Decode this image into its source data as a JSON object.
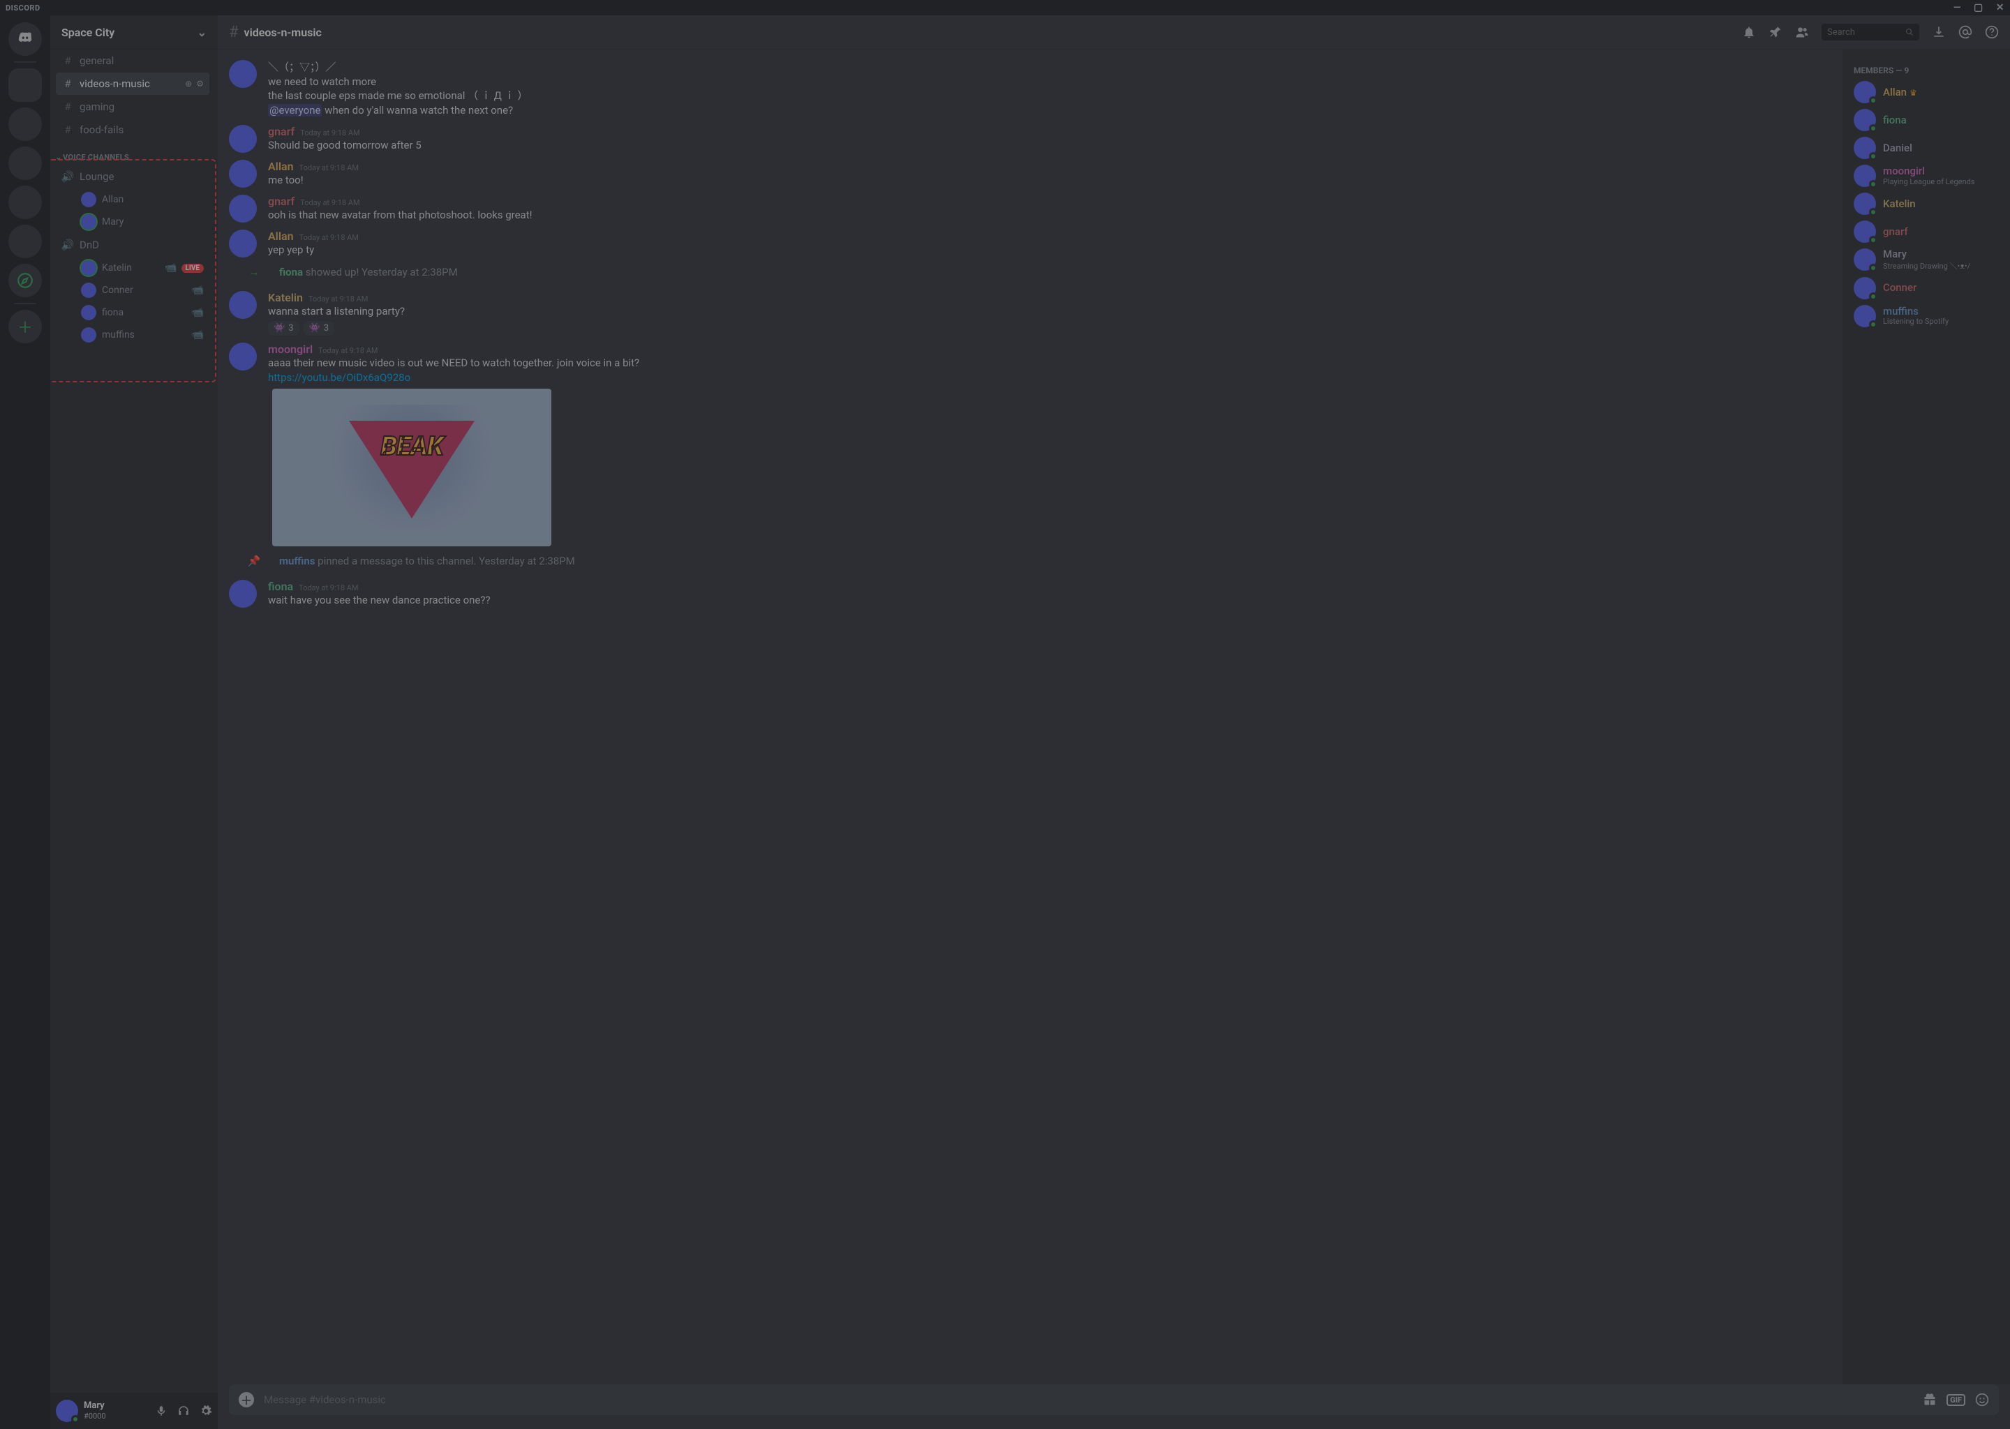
{
  "titlebar": {
    "brand": "DISCORD"
  },
  "server": {
    "name": "Space City"
  },
  "textChannels": [
    {
      "name": "general",
      "active": false
    },
    {
      "name": "videos-n-music",
      "active": true
    },
    {
      "name": "gaming",
      "active": false
    },
    {
      "name": "food-fails",
      "active": false
    }
  ],
  "voiceHeader": "VOICE CHANNELS",
  "voiceChannels": [
    {
      "name": "Lounge",
      "users": [
        {
          "name": "Allan",
          "speaking": false,
          "av": "av-b6"
        },
        {
          "name": "Mary",
          "speaking": true,
          "av": "av-b3"
        }
      ]
    },
    {
      "name": "DnD",
      "users": [
        {
          "name": "Katelin",
          "speaking": true,
          "av": "av-b5",
          "video": true,
          "live": true
        },
        {
          "name": "Conner",
          "speaking": false,
          "av": "av-b6",
          "video": true
        },
        {
          "name": "fiona",
          "speaking": false,
          "av": "av-b7",
          "video": true
        },
        {
          "name": "muffins",
          "speaking": false,
          "av": "av-b1",
          "video": true
        }
      ]
    }
  ],
  "userPanel": {
    "name": "Mary",
    "discriminator": "#0000"
  },
  "chatHeader": {
    "channel": "videos-n-music"
  },
  "search": {
    "placeholder": "Search"
  },
  "messages": {
    "0": {
      "kaomoji": "＼（；▽；）／",
      "l1": "we need to watch more",
      "l2a": "the last couple eps made me so emotional （ ｉ Д ｉ ）",
      "mention": "@everyone",
      "l3b": " when do y'all wanna watch the next one?"
    },
    "1": {
      "author": "gnarf",
      "ts": "Today at 9:18 AM",
      "body": "Should be good tomorrow after 5"
    },
    "2": {
      "author": "Allan",
      "ts": "Today at 9:18 AM",
      "body": "me too!"
    },
    "3": {
      "author": "gnarf",
      "ts": "Today at 9:18 AM",
      "body": "ooh is that new avatar from that photoshoot. looks great!"
    },
    "4": {
      "author": "Allan",
      "ts": "Today at 9:18 AM",
      "body": "yep yep ty"
    },
    "5": {
      "sys": "fiona",
      "sysRest": " showed up!",
      "ts": "Yesterday at 2:38PM"
    },
    "6": {
      "author": "Katelin",
      "ts": "Today at 9:18 AM",
      "body": "wanna start a listening party?",
      "r1": "3",
      "r2": "3"
    },
    "7": {
      "author": "moongirl",
      "ts": "Today at 9:18 AM",
      "body": "aaaa their new music video is out we NEED to watch together. join voice in a bit?",
      "link": "https://youtu.be/OiDx6aQ928o",
      "embedLogo": "BEAK"
    },
    "8": {
      "sysA": "muffins",
      "sysB": " pinned a message to this channel.",
      "ts": "Yesterday at 2:38PM"
    },
    "9": {
      "author": "fiona",
      "ts": "Today at 9:18 AM",
      "body": "wait have you see the new dance practice one??"
    }
  },
  "input": {
    "placeholder": "Message #videos-n-music"
  },
  "membersHeader": "MEMBERS — 9",
  "members": [
    {
      "name": "Allan",
      "cls": "c-allan",
      "av": "av-b6",
      "crown": true
    },
    {
      "name": "fiona",
      "cls": "c-fiona",
      "av": "av-b8"
    },
    {
      "name": "Daniel",
      "cls": "c-daniel",
      "av": "av-b6"
    },
    {
      "name": "moongirl",
      "cls": "c-moongirl",
      "av": "av-b4",
      "sub": "Playing League of Legends"
    },
    {
      "name": "Katelin",
      "cls": "c-katelin",
      "av": "av-b5"
    },
    {
      "name": "gnarf",
      "cls": "c-gnarf",
      "av": "av-b6"
    },
    {
      "name": "Mary",
      "cls": "c-mary",
      "av": "av-b3",
      "sub": "Streaming Drawing ＼•ᴥ•/"
    },
    {
      "name": "Conner",
      "cls": "c-conner",
      "av": "av-b6"
    },
    {
      "name": "muffins",
      "cls": "c-muffins",
      "av": "av-b1",
      "sub": "Listening to Spotify"
    }
  ],
  "liveLabel": "LIVE",
  "gifLabel": "GIF"
}
